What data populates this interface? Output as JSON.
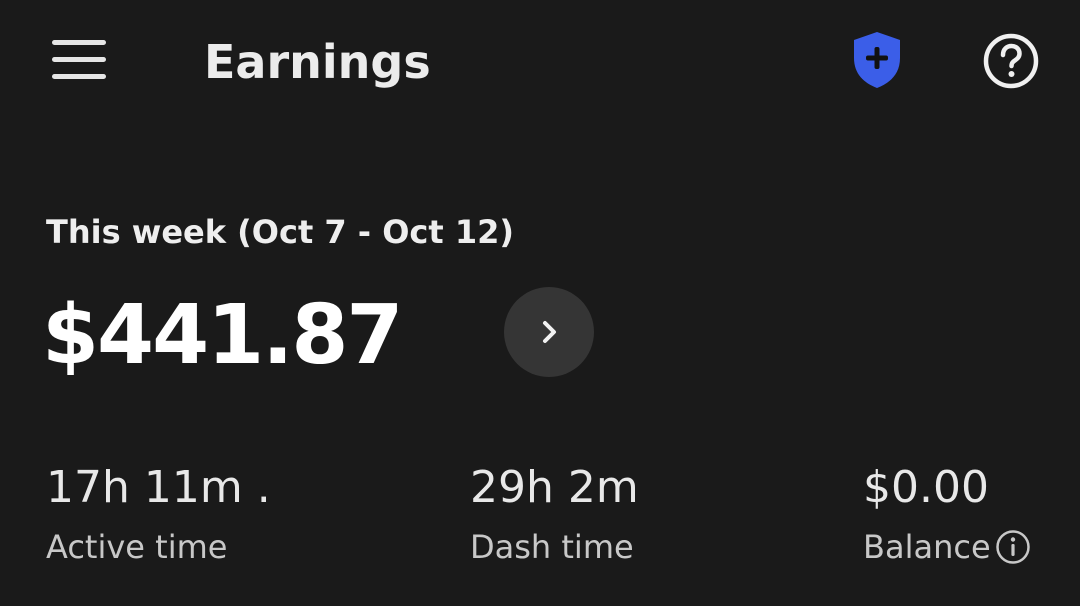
{
  "header": {
    "title": "Earnings",
    "icons": {
      "menu": "hamburger-menu-icon",
      "safety": "shield-plus-icon",
      "help": "question-mark-circle-icon"
    },
    "colors": {
      "background": "#1a1a1a",
      "shield": "#3b5ee8"
    }
  },
  "summary": {
    "week_label": "This week (Oct 7 - Oct 12)",
    "amount": "$441.87",
    "details_icon": "chevron-right-icon"
  },
  "stats": [
    {
      "value": "17h 11m .",
      "label": "Active time"
    },
    {
      "value": "29h 2m",
      "label": "Dash time"
    },
    {
      "value": "$0.00",
      "label": "Balance",
      "icon": "info-circle-icon"
    }
  ]
}
